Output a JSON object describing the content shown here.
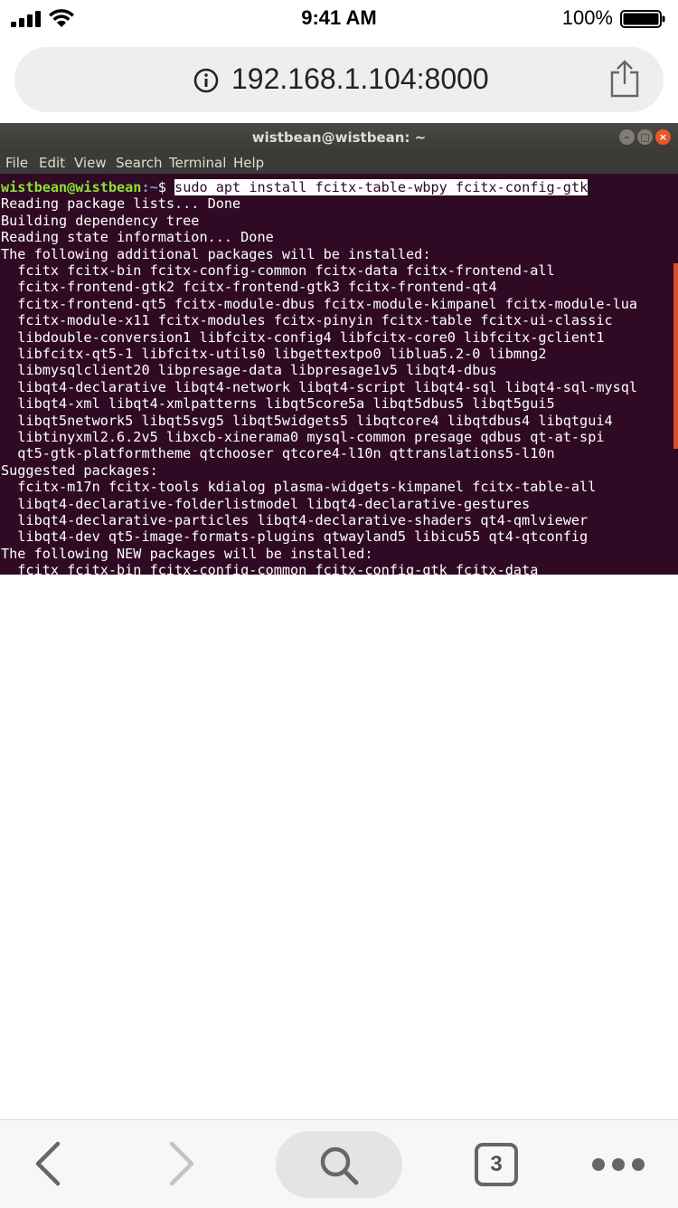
{
  "status_bar": {
    "time": "9:41 AM",
    "battery_percent": "100%",
    "battery_level": 1.0
  },
  "browser": {
    "url": "192.168.1.104:8000",
    "tab_count": "3",
    "icons": [
      "info-icon",
      "share-icon",
      "back-icon",
      "forward-icon",
      "search-icon",
      "tabs-icon",
      "more-icon"
    ]
  },
  "terminal": {
    "title": "wistbean@wistbean: ~",
    "menu": [
      "File",
      "Edit",
      "View",
      "Search",
      "Terminal",
      "Help"
    ],
    "prompt_user": "wistbean@wistbean",
    "prompt_path": ":~",
    "prompt_symbol": "$ ",
    "command": "sudo apt install fcitx-table-wbpy fcitx-config-gtk",
    "lines": [
      "Reading package lists... Done",
      "Building dependency tree",
      "Reading state information... Done",
      "The following additional packages will be installed:",
      "  fcitx fcitx-bin fcitx-config-common fcitx-data fcitx-frontend-all",
      "  fcitx-frontend-gtk2 fcitx-frontend-gtk3 fcitx-frontend-qt4",
      "  fcitx-frontend-qt5 fcitx-module-dbus fcitx-module-kimpanel fcitx-module-lua",
      "  fcitx-module-x11 fcitx-modules fcitx-pinyin fcitx-table fcitx-ui-classic",
      "  libdouble-conversion1 libfcitx-config4 libfcitx-core0 libfcitx-gclient1",
      "  libfcitx-qt5-1 libfcitx-utils0 libgettextpo0 liblua5.2-0 libmng2",
      "  libmysqlclient20 libpresage-data libpresage1v5 libqt4-dbus",
      "  libqt4-declarative libqt4-network libqt4-script libqt4-sql libqt4-sql-mysql",
      "  libqt4-xml libqt4-xmlpatterns libqt5core5a libqt5dbus5 libqt5gui5",
      "  libqt5network5 libqt5svg5 libqt5widgets5 libqtcore4 libqtdbus4 libqtgui4",
      "  libtinyxml2.6.2v5 libxcb-xinerama0 mysql-common presage qdbus qt-at-spi",
      "  qt5-gtk-platformtheme qtchooser qtcore4-l10n qttranslations5-l10n",
      "Suggested packages:",
      "  fcitx-m17n fcitx-tools kdialog plasma-widgets-kimpanel fcitx-table-all",
      "  libqt4-declarative-folderlistmodel libqt4-declarative-gestures",
      "  libqt4-declarative-particles libqt4-declarative-shaders qt4-qmlviewer",
      "  libqt4-dev qt5-image-formats-plugins qtwayland5 libicu55 qt4-qtconfig",
      "The following NEW packages will be installed:",
      "  fcitx fcitx-bin fcitx-config-common fcitx-config-gtk fcitx-data"
    ]
  },
  "colors": {
    "terminal_bg": "#300a24",
    "prompt_user": "#8ae234",
    "prompt_path": "#729fcf",
    "close_button": "#e9562a"
  }
}
